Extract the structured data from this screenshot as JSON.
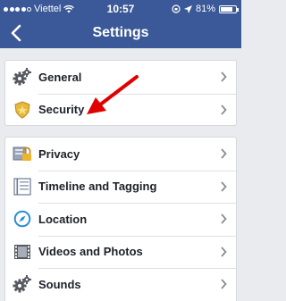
{
  "status_bar": {
    "carrier": "Viettel",
    "time": "10:57",
    "battery_percent": "81%",
    "battery_level": 0.81,
    "icons": [
      "signal-dots",
      "wifi-icon",
      "rotation-lock-icon",
      "location-arrow-icon",
      "battery-icon"
    ]
  },
  "nav": {
    "back_icon": "chevron-left-icon",
    "title": "Settings"
  },
  "groups": [
    {
      "items": [
        {
          "label": "General",
          "icon": "gears-icon"
        },
        {
          "label": "Security",
          "icon": "security-badge-icon"
        }
      ]
    },
    {
      "items": [
        {
          "label": "Privacy",
          "icon": "privacy-lock-icon"
        },
        {
          "label": "Timeline and Tagging",
          "icon": "timeline-icon"
        },
        {
          "label": "Location",
          "icon": "compass-icon"
        },
        {
          "label": "Videos and Photos",
          "icon": "film-icon"
        },
        {
          "label": "Sounds",
          "icon": "gears-icon"
        }
      ]
    }
  ],
  "colors": {
    "nav_background": "#3b5998",
    "page_background": "#e9ebee",
    "annotation_arrow": "#e00000"
  }
}
